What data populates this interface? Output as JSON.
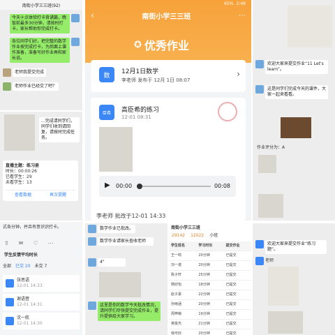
{
  "top_left": {
    "title": "南街小学三三班(92)",
    "msg1": "今天十点体验打卡背诵篇，晚饭前最多30分钟，请按时打卡，家长帮助你完成打卡。",
    "msg2": "各位同学们好，把完整的数学作业按完成打卡，为后面上课作准备，准备写好作业再和家长说。",
    "msg3": "老师我提交完成",
    "msg4": "老师作业已经交了吧？"
  },
  "mid_left": {
    "notice": "...完成请同学们，同学们收到请回复，请按时完成任务。",
    "live_title": "直播主题：练习册",
    "live_duration_label": "时长：",
    "live_duration": "00:00:26",
    "live_watch_label": "已看学生：",
    "live_watch": "29",
    "live_unwatch_label": "未看学生：",
    "live_unwatch": "13",
    "btn_view": "查看数据",
    "btn_notify": "再次提醒"
  },
  "bottom_left": {
    "caption": "式各分钟，并且有意识识打卡。",
    "section": "学生反馈平均时长",
    "tabs": [
      "全部",
      "已交 20",
      "未交 7"
    ],
    "students": [
      {
        "name": "张思语",
        "time": "12-01 14:33"
      },
      {
        "name": "谢语萱",
        "time": "12-01 14:31"
      },
      {
        "name": "沈一航",
        "time": "12-01 14:30"
      }
    ]
  },
  "center": {
    "status_time": "2:49",
    "status_battery": "65%",
    "class_name": "南街小学三三班",
    "banner_title": "优秀作业",
    "hw_badge": "数",
    "hw_title": "12月1日数学",
    "hw_meta": "李老师 发布于 12月 1日 08:07",
    "student_badge": "臣希",
    "student_title": "高臣希的练习",
    "student_time": "12-01 08:31",
    "audio_start": "00:00",
    "audio_end": "00:08",
    "review": "李老师 批改于12-01 14:33"
  },
  "bottom_center": {
    "msg1": "数学作业已批改。",
    "msg2": "数学作业请家长查收老师",
    "msg3": "这里是你的数学今天批改情况，请同学们尽快提交完成作业，提升提供给大家学习。",
    "voice": "4\""
  },
  "bottom_right_table": {
    "header_title": "南街小学三三班",
    "stats": [
      "29142",
      "12022",
      "小班"
    ],
    "columns": [
      "学生姓名",
      "学习时长",
      "提交作业"
    ],
    "rows": [
      [
        "王一鸣",
        "20分钟",
        "已提交"
      ],
      [
        "刘一诺",
        "20分钟",
        "已提交"
      ],
      [
        "陈子轩",
        "25分钟",
        "已提交"
      ],
      [
        "杨欣怡",
        "18分钟",
        "已提交"
      ],
      [
        "赵子豪",
        "22分钟",
        "已提交"
      ],
      [
        "孙雨涵",
        "20分钟",
        "已提交"
      ],
      [
        "周梓萌",
        "19分钟",
        "已提交"
      ],
      [
        "吴俊杰",
        "21分钟",
        "已提交"
      ],
      [
        "徐可欣",
        "20分钟",
        "已提交"
      ]
    ]
  },
  "top_right": {
    "msg1": "欢迎大家来提交作业“11 Let's learn”。",
    "msg2": "这是同学们完成今天的课件，大家一起来看看。",
    "student": "作业评分为：",
    "score": "A"
  },
  "bottom_right_chat": {
    "msg1": "欢迎大家来提交作业“练习题”。",
    "label": "老师"
  }
}
